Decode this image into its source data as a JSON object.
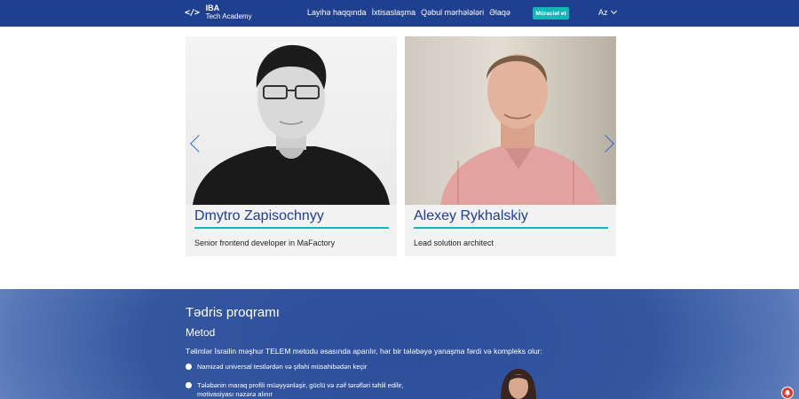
{
  "header": {
    "logo_line1": "IBA",
    "logo_line2": "Tech Academy",
    "logo_mark": "</>",
    "nav": [
      "Layihə haqqında",
      "İxtisaslaşma",
      "Qəbul mərhələləri",
      "Əlaqə"
    ],
    "apply_label": "Müraciət et",
    "lang_label": "Az",
    "lang_icon": "chevron-down-icon"
  },
  "carousel": {
    "cards": [
      {
        "name": "Dmytro Zapisochnyy",
        "role": "Senior frontend developer in MaFactory"
      },
      {
        "name": "Alexey Rykhalskiy",
        "role": "Lead solution architect"
      }
    ],
    "prev_icon": "chevron-left-icon",
    "next_icon": "chevron-right-icon"
  },
  "program": {
    "title": "Tədris proqramı",
    "subtitle": "Metod",
    "intro": "Təlimlər İsrailin məşhur TELEM metodu əsasında aparılır, hər bir tələbəyə yanaşma fərdi və kompleks olur:",
    "bullets": [
      "Namizəd universal testlərdən və şifahi müsahibədən keçir",
      "Tələbənin maraq profili müəyyənləşir, güclü və zəif tərəfləri təhlil edilir, motivasiyası nəzərə alınır"
    ]
  },
  "colors": {
    "header": "#1f3f8f",
    "accent": "#17b5b5",
    "name": "#1f3f8f",
    "arrow": "#2a6bd8",
    "notification": "#e23b2e"
  }
}
